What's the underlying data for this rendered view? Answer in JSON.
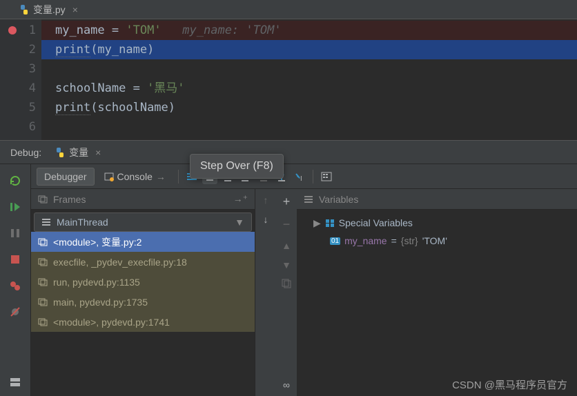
{
  "editor": {
    "tab": {
      "filename": "变量.py"
    },
    "lines": [
      {
        "n": "1",
        "cls": "line-bp",
        "segs": [
          {
            "t": "my_name",
            "c": "ident"
          },
          {
            "t": " = ",
            "c": ""
          },
          {
            "t": "'TOM'",
            "c": "str"
          },
          {
            "t": "   ",
            "c": ""
          },
          {
            "t": "my_name: 'TOM'",
            "c": "hint em-ident"
          }
        ]
      },
      {
        "n": "2",
        "cls": "line-exec",
        "segs": [
          {
            "t": "print",
            "c": "fn fn-ul"
          },
          {
            "t": "(my_name)",
            "c": "ident"
          }
        ]
      },
      {
        "n": "3",
        "cls": "",
        "segs": []
      },
      {
        "n": "4",
        "cls": "",
        "segs": [
          {
            "t": "schoolName = ",
            "c": "ident"
          },
          {
            "t": "'黑马'",
            "c": "str"
          }
        ]
      },
      {
        "n": "5",
        "cls": "",
        "segs": [
          {
            "t": "print",
            "c": "fn fn-ul"
          },
          {
            "t": "(schoolName)",
            "c": "ident"
          }
        ]
      },
      {
        "n": "6",
        "cls": "",
        "segs": []
      }
    ]
  },
  "debug": {
    "title": "Debug:",
    "tab": "变量",
    "tooltip": "Step Over (F8)",
    "toolbar": {
      "debugger": "Debugger",
      "console": "Console"
    },
    "frames_panel": "Frames",
    "vars_panel": "Variables",
    "thread": "MainThread",
    "frames": [
      "<module>, 变量.py:2",
      "execfile, _pydev_execfile.py:18",
      "run, pydevd.py:1135",
      "main, pydevd.py:1735",
      "<module>, pydevd.py:1741"
    ],
    "special_vars": "Special Variables",
    "var": {
      "name": "my_name",
      "type": "{str}",
      "value": "'TOM'"
    }
  },
  "watermark": "CSDN @黑马程序员官方"
}
